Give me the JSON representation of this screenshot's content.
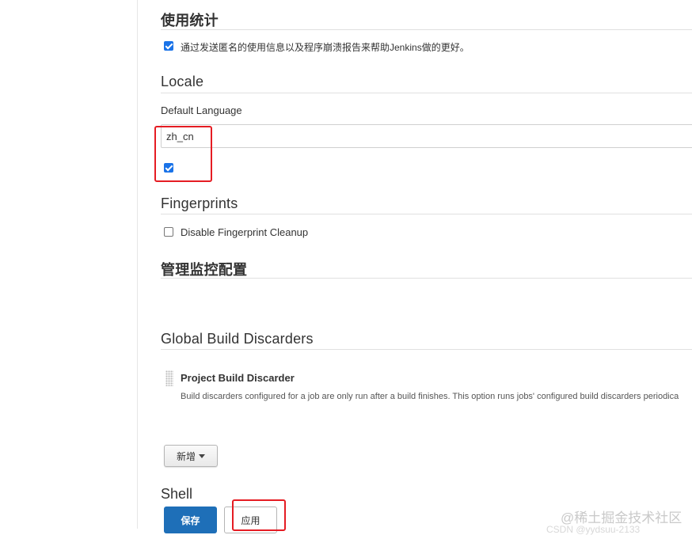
{
  "usage": {
    "title": "使用统计",
    "checkbox_label": "通过发送匿名的使用信息以及程序崩溃报告来帮助Jenkins做的更好。",
    "checked": true
  },
  "locale": {
    "title": "Locale",
    "default_language_label": "Default Language",
    "default_language_value": "zh_cn",
    "ignore_browser_checked": true
  },
  "fingerprints": {
    "title": "Fingerprints",
    "disable_cleanup_label": "Disable Fingerprint Cleanup",
    "checked": false
  },
  "monitor": {
    "title": "管理监控配置"
  },
  "global_build_discarders": {
    "title": "Global Build Discarders",
    "item_title": "Project Build Discarder",
    "item_description": "Build discarders configured for a job are only run after a build finishes. This option runs jobs' configured build discarders periodica",
    "add_button_label": "新增"
  },
  "shell": {
    "title": "Shell"
  },
  "actions": {
    "save_label": "保存",
    "apply_label": "应用"
  },
  "watermark": {
    "text": "@稀土掘金技术社区",
    "subtext": "CSDN @yydsuu-2133"
  },
  "colors": {
    "save_button": "#1e6fb8",
    "highlight_box": "#e51c23",
    "checkbox_checked": "#1a73e8"
  }
}
